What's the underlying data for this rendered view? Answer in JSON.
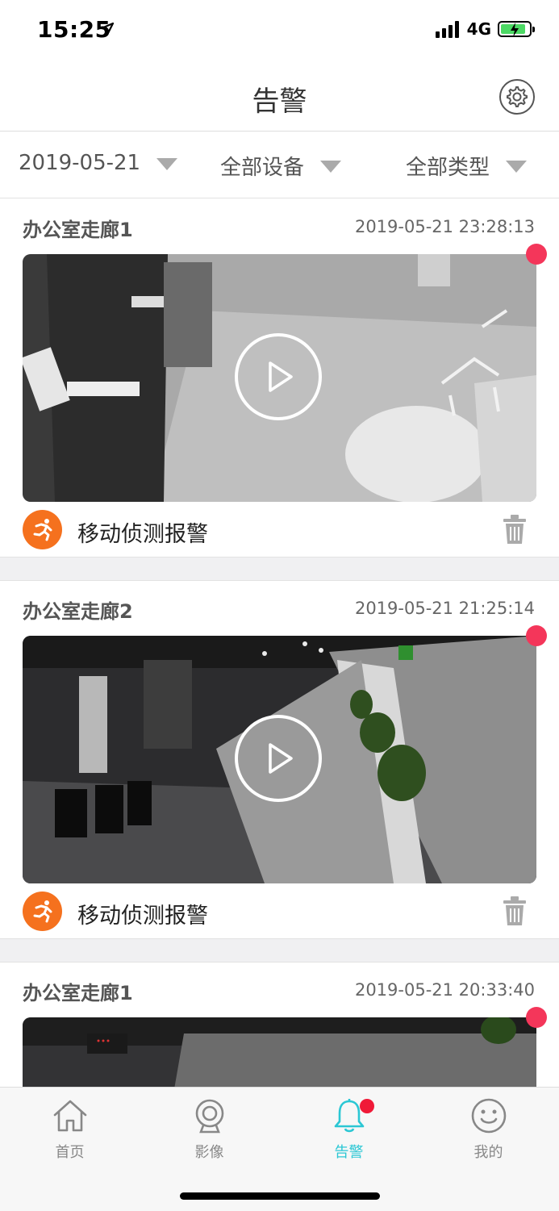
{
  "status_bar": {
    "time": "15:25",
    "network": "4G"
  },
  "header": {
    "title": "告警"
  },
  "filters": {
    "date": "2019-05-21",
    "device": "全部设备",
    "type": "全部类型"
  },
  "alarms": [
    {
      "device": "办公室走廊1",
      "time": "2019-05-21 23:28:13",
      "type": "移动侦测报警",
      "unread": true
    },
    {
      "device": "办公室走廊2",
      "time": "2019-05-21 21:25:14",
      "type": "移动侦测报警",
      "unread": true
    },
    {
      "device": "办公室走廊1",
      "time": "2019-05-21 20:33:40",
      "type": "",
      "unread": true
    }
  ],
  "tabs": [
    {
      "label": "首页",
      "icon": "home-icon"
    },
    {
      "label": "影像",
      "icon": "camera-icon"
    },
    {
      "label": "告警",
      "icon": "bell-icon",
      "active": true,
      "badge": true
    },
    {
      "label": "我的",
      "icon": "smile-icon"
    }
  ],
  "colors": {
    "accent": "#2bc7d4",
    "alarm_icon": "#f5711e",
    "unread_dot": "#f4365a"
  }
}
